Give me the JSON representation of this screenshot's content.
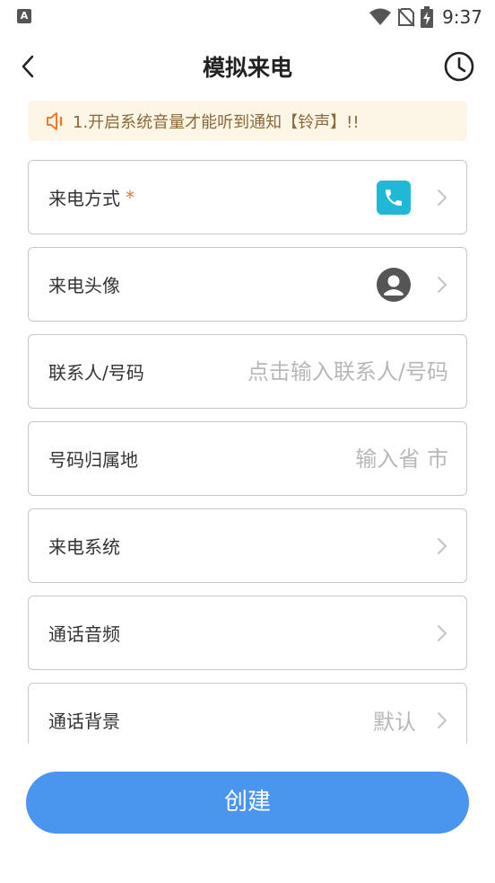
{
  "status_bar": {
    "left_icon_label": "A",
    "time": "9:37",
    "icons": [
      "wifi-icon",
      "no-sim-icon",
      "battery-charging-icon"
    ]
  },
  "nav": {
    "title": "模拟来电",
    "back_icon": "chevron-left-icon",
    "history_icon": "clock-icon"
  },
  "notice": {
    "icon": "speaker-icon",
    "text": "1.开启系统音量才能听到通知【铃声】!!",
    "accent_color": "#f07a2a"
  },
  "form": {
    "call_method": {
      "label": "来电方式",
      "required": "*",
      "icon": "phone-icon"
    },
    "avatar": {
      "label": "来电头像",
      "icon": "user-avatar-icon"
    },
    "contact": {
      "label": "联系人/号码",
      "placeholder": "点击输入联系人/号码",
      "value": ""
    },
    "location": {
      "label": "号码归属地",
      "placeholder": "输入省 市",
      "value": ""
    },
    "system": {
      "label": "来电系统"
    },
    "audio": {
      "label": "通话音频"
    },
    "background": {
      "label": "通话背景",
      "value": "默认"
    }
  },
  "create_button": {
    "label": "创建",
    "color": "#4a95ee"
  }
}
